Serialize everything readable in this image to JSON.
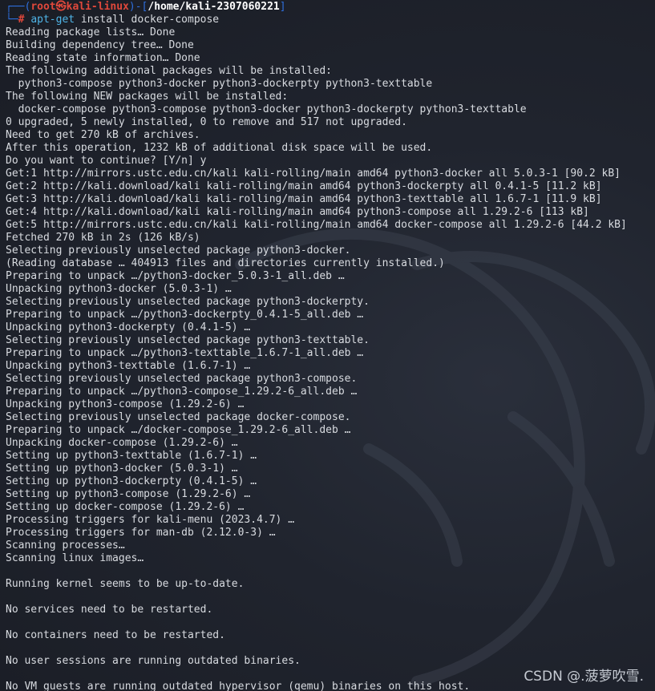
{
  "prompt": {
    "frame_top_left": "┌──(",
    "user": "root㉿kali-linux",
    "frame_mid": ")-[",
    "cwd": "/home/kali-2307060221",
    "frame_end": "]",
    "frame_bottom": "└─",
    "symbol": "#",
    "command_name": "apt-get",
    "command_args": " install docker-compose"
  },
  "output_lines": [
    "Reading package lists… Done",
    "Building dependency tree… Done",
    "Reading state information… Done",
    "The following additional packages will be installed:",
    "  python3-compose python3-docker python3-dockerpty python3-texttable",
    "The following NEW packages will be installed:",
    "  docker-compose python3-compose python3-docker python3-dockerpty python3-texttable",
    "0 upgraded, 5 newly installed, 0 to remove and 517 not upgraded.",
    "Need to get 270 kB of archives.",
    "After this operation, 1232 kB of additional disk space will be used.",
    "Do you want to continue? [Y/n] y",
    "Get:1 http://mirrors.ustc.edu.cn/kali kali-rolling/main amd64 python3-docker all 5.0.3-1 [90.2 kB]",
    "Get:2 http://kali.download/kali kali-rolling/main amd64 python3-dockerpty all 0.4.1-5 [11.2 kB]",
    "Get:3 http://kali.download/kali kali-rolling/main amd64 python3-texttable all 1.6.7-1 [11.9 kB]",
    "Get:4 http://kali.download/kali kali-rolling/main amd64 python3-compose all 1.29.2-6 [113 kB]",
    "Get:5 http://mirrors.ustc.edu.cn/kali kali-rolling/main amd64 docker-compose all 1.29.2-6 [44.2 kB]",
    "Fetched 270 kB in 2s (126 kB/s)",
    "Selecting previously unselected package python3-docker.",
    "(Reading database … 404913 files and directories currently installed.)",
    "Preparing to unpack …/python3-docker_5.0.3-1_all.deb …",
    "Unpacking python3-docker (5.0.3-1) …",
    "Selecting previously unselected package python3-dockerpty.",
    "Preparing to unpack …/python3-dockerpty_0.4.1-5_all.deb …",
    "Unpacking python3-dockerpty (0.4.1-5) …",
    "Selecting previously unselected package python3-texttable.",
    "Preparing to unpack …/python3-texttable_1.6.7-1_all.deb …",
    "Unpacking python3-texttable (1.6.7-1) …",
    "Selecting previously unselected package python3-compose.",
    "Preparing to unpack …/python3-compose_1.29.2-6_all.deb …",
    "Unpacking python3-compose (1.29.2-6) …",
    "Selecting previously unselected package docker-compose.",
    "Preparing to unpack …/docker-compose_1.29.2-6_all.deb …",
    "Unpacking docker-compose (1.29.2-6) …",
    "Setting up python3-texttable (1.6.7-1) …",
    "Setting up python3-docker (5.0.3-1) …",
    "Setting up python3-dockerpty (0.4.1-5) …",
    "Setting up python3-compose (1.29.2-6) …",
    "Setting up docker-compose (1.29.2-6) …",
    "Processing triggers for kali-menu (2023.4.7) …",
    "Processing triggers for man-db (2.12.0-3) …",
    "Scanning processes…",
    "Scanning linux images…",
    "",
    "Running kernel seems to be up-to-date.",
    "",
    "No services need to be restarted.",
    "",
    "No containers need to be restarted.",
    "",
    "No user sessions are running outdated binaries.",
    "",
    "No VM guests are running outdated hypervisor (qemu) binaries on this host."
  ],
  "watermark": "CSDN @.菠萝吹雪.",
  "colors": {
    "background": "#1b1e27",
    "text": "#d8dbe0",
    "prompt_frame": "#2f6fde",
    "prompt_user": "#e0483b",
    "command": "#4fb5e8"
  }
}
